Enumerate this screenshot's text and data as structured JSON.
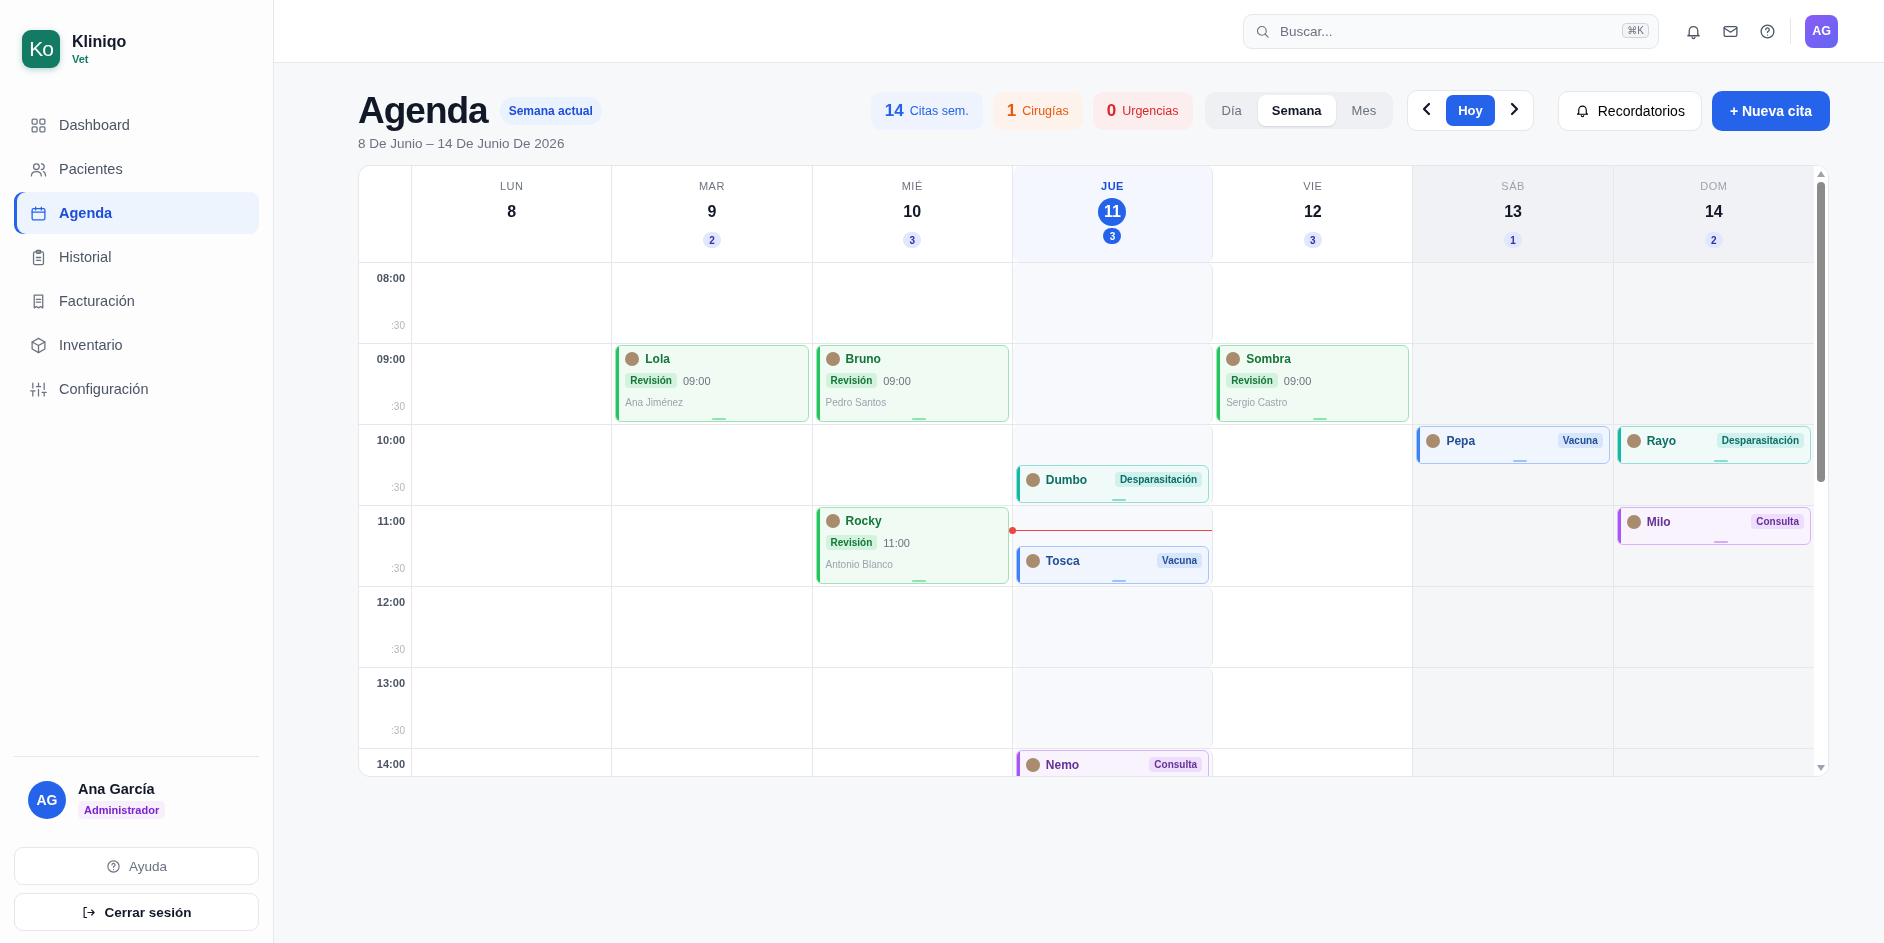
{
  "sidebar": {
    "brand": {
      "logo": "Ko",
      "name": "Kliniqo",
      "subtitle": "Vet"
    },
    "items": [
      {
        "label": "Dashboard",
        "kind": "dashboard",
        "selected": false
      },
      {
        "label": "Pacientes",
        "kind": "patients",
        "selected": false
      },
      {
        "label": "Agenda",
        "kind": "calendar",
        "selected": true
      },
      {
        "label": "Historial",
        "kind": "history",
        "selected": false
      },
      {
        "label": "Facturación",
        "kind": "billing",
        "selected": false
      },
      {
        "label": "Inventario",
        "kind": "inventory",
        "selected": false
      },
      {
        "label": "Configuración",
        "kind": "settings",
        "selected": false
      }
    ],
    "user": {
      "initials": "AG",
      "name": "Ana García",
      "role": "Administrador"
    },
    "buttons": [
      {
        "label": "Ayuda",
        "kind": "help"
      },
      {
        "label": "Cerrar sesión",
        "kind": "logout"
      }
    ]
  },
  "topbar": {
    "search": {
      "placeholder": "Buscar...",
      "shortcut": "⌘K"
    },
    "avatar": "AG"
  },
  "header": {
    "title": "Agenda",
    "badge": "Semana actual",
    "range": "8 De Junio – 14 De Junio De 2026",
    "stats": [
      {
        "value": "14",
        "label": "Citas sem.",
        "color": "#2563eb"
      },
      {
        "value": "1",
        "label": "Cirugías",
        "color": "#ea580c"
      },
      {
        "value": "0",
        "label": "Urgencias",
        "color": "#dc2626"
      }
    ],
    "views": [
      {
        "label": "Día",
        "selected": false
      },
      {
        "label": "Semana",
        "selected": true
      },
      {
        "label": "Mes",
        "selected": false
      }
    ],
    "today": "Hoy",
    "reminders": "Recordatorios",
    "new_button": "+ Nueva cita"
  },
  "calendar": {
    "days": [
      {
        "weekday": "LUN",
        "date": "8",
        "selected": false,
        "weekend": false
      },
      {
        "weekday": "MAR",
        "date": "9",
        "count": "2",
        "selected": false,
        "weekend": false
      },
      {
        "weekday": "MIÉ",
        "date": "10",
        "count": "3",
        "selected": false,
        "weekend": false
      },
      {
        "weekday": "JUE",
        "date": "11",
        "count": "3",
        "selected": true,
        "weekend": false
      },
      {
        "weekday": "VIE",
        "date": "12",
        "count": "3",
        "selected": false,
        "weekend": false
      },
      {
        "weekday": "SÁB",
        "date": "13",
        "count": "1",
        "selected": false,
        "weekend": true
      },
      {
        "weekday": "DOM",
        "date": "14",
        "count": "2",
        "selected": false,
        "weekend": true
      }
    ],
    "hours": [
      {
        "label": "08:00",
        "half": ":30",
        "cells": [
          [],
          [],
          [],
          [],
          [],
          [],
          []
        ]
      },
      {
        "label": "09:00",
        "half": ":30",
        "cells": [
          [],
          [
            {
              "pet": "Lola",
              "type": "Revisión",
              "time": "09:00",
              "vet": "Ana Jiménez",
              "kind": "full",
              "color": "#22c55e"
            }
          ],
          [
            {
              "pet": "Bruno",
              "type": "Revisión",
              "time": "09:00",
              "vet": "Pedro Santos",
              "kind": "full",
              "color": "#22c55e"
            }
          ],
          [],
          [
            {
              "pet": "Sombra",
              "type": "Revisión",
              "time": "09:00",
              "vet": "Sergio Castro",
              "kind": "full",
              "color": "#22c55e"
            }
          ],
          [],
          []
        ]
      },
      {
        "label": "10:00",
        "half": ":30",
        "half_cells": [
          [],
          [],
          [],
          [
            {
              "pet": "Dumbo",
              "type": "Desparasitación",
              "kind": "compact",
              "color": "#14b8a6"
            }
          ],
          [],
          [],
          []
        ],
        "cells": [
          [],
          [],
          [],
          [],
          [],
          [
            {
              "pet": "Pepa",
              "type": "Vacuna",
              "kind": "compact",
              "color": "#3b82f6"
            }
          ],
          [
            {
              "pet": "Rayo",
              "type": "Desparasitación",
              "kind": "compact",
              "color": "#14b8a6"
            }
          ]
        ]
      },
      {
        "label": "11:00",
        "half": ":30",
        "now_line": true,
        "half_cells": [
          [],
          [],
          [],
          [
            {
              "pet": "Tosca",
              "type": "Vacuna",
              "kind": "compact",
              "color": "#3b82f6"
            }
          ],
          [],
          [],
          []
        ],
        "cells": [
          [],
          [],
          [
            {
              "pet": "Rocky",
              "type": "Revisión",
              "time": "11:00",
              "vet": "Antonio Blanco",
              "kind": "full",
              "color": "#22c55e"
            }
          ],
          [],
          [],
          [],
          [
            {
              "pet": "Milo",
              "type": "Consulta",
              "kind": "compact",
              "color": "#a855f7"
            }
          ]
        ]
      },
      {
        "label": "12:00",
        "half": ":30",
        "cells": [
          [],
          [],
          [],
          [],
          [],
          [],
          []
        ]
      },
      {
        "label": "13:00",
        "half": ":30",
        "cells": [
          [],
          [],
          [],
          [],
          [],
          [],
          []
        ]
      },
      {
        "label": "14:00",
        "cells": [
          [],
          [],
          [],
          [
            {
              "pet": "Nemo",
              "type": "Consulta",
              "kind": "compact",
              "color": "#a855f7"
            }
          ],
          [],
          [],
          []
        ]
      }
    ]
  }
}
